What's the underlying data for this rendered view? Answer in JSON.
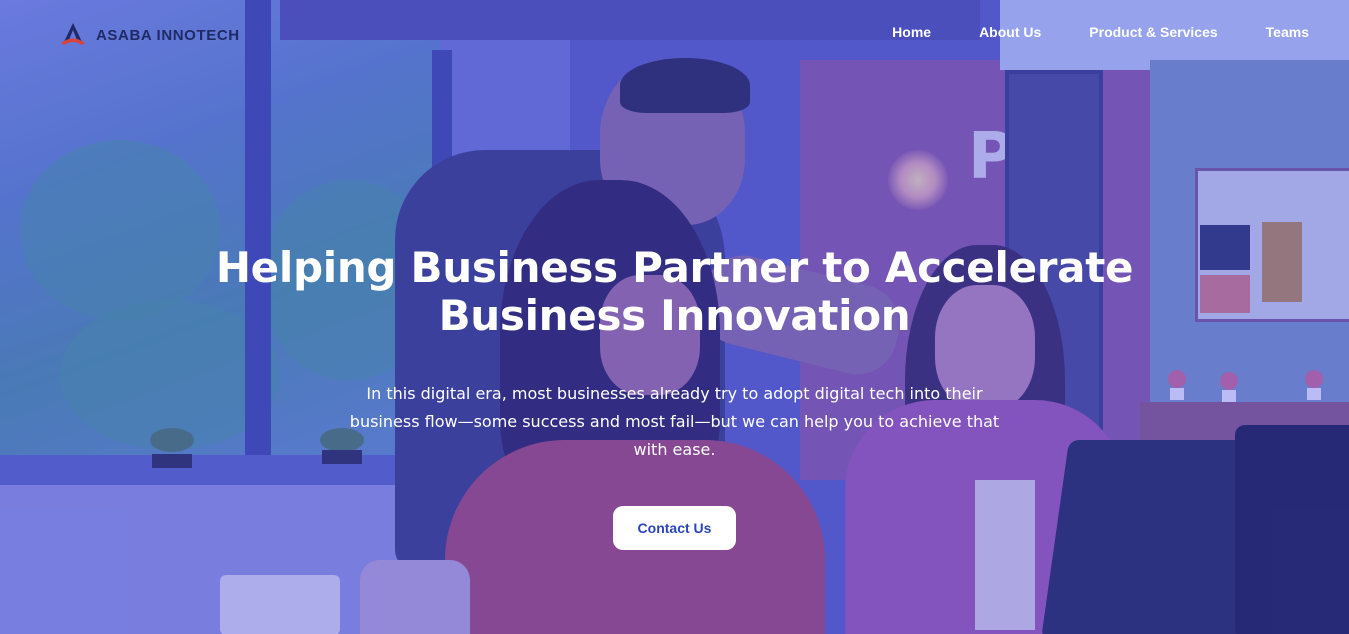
{
  "brand": {
    "name": "ASABA INNOTECH",
    "logo_icon": "asaba-logo-icon",
    "text_color": "#1f2a66",
    "accent_color": "#d9433a"
  },
  "nav": {
    "items": [
      {
        "label": "Home"
      },
      {
        "label": "About Us"
      },
      {
        "label": "Product & Services"
      },
      {
        "label": "Teams"
      }
    ]
  },
  "hero": {
    "title": "Helping Business Partner to Accelerate Business Innovation",
    "subtitle": "In this digital era, most businesses already try to adopt digital tech into their business flow—some success and most fail—but we can help you to achieve that with ease.",
    "cta_label": "Contact Us",
    "cta_text_color": "#2b45b8",
    "overlay_color": "#3e46dc"
  }
}
